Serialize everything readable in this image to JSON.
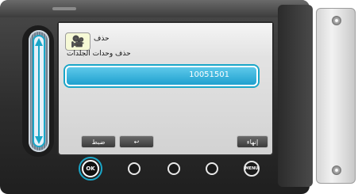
{
  "screen": {
    "title": "حذف",
    "subtitle": "حذف وحدات الجلدات",
    "selected_value": "10051501"
  },
  "softkeys": {
    "set_label": "ضبط",
    "back_icon": "↩",
    "end_label": "إنهاء"
  },
  "buttons": {
    "ok_label": "OK",
    "menu_label": "MENU"
  },
  "icons": {
    "camera": "🎥"
  },
  "colors": {
    "accent": "#1aa6c8",
    "field": "#1fa0cf",
    "body": "#2d2d2d"
  }
}
